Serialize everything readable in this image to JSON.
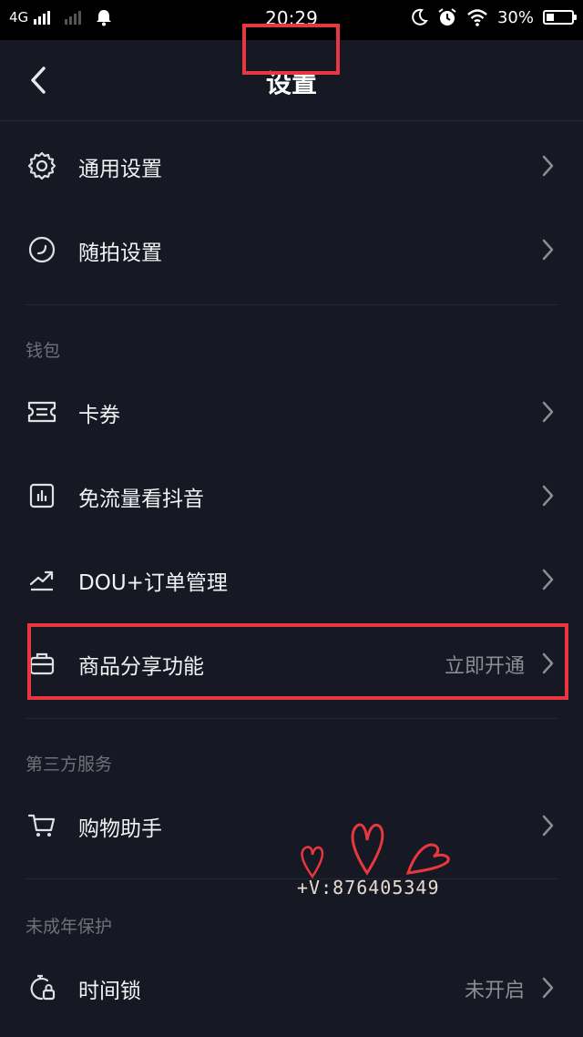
{
  "status_bar": {
    "network": "4G",
    "time": "20:29",
    "battery": "30%",
    "battery_level": 0.3
  },
  "header": {
    "title": "设置"
  },
  "sections": [
    {
      "title": "",
      "items": [
        {
          "label": "通用设置",
          "icon": "gear-icon"
        },
        {
          "label": "随拍设置",
          "icon": "circle-clock-icon"
        }
      ]
    },
    {
      "title": "钱包",
      "items": [
        {
          "label": "卡券",
          "icon": "ticket-icon"
        },
        {
          "label": "免流量看抖音",
          "icon": "data-chart-icon"
        },
        {
          "label": "DOU+订单管理",
          "icon": "trend-up-icon"
        },
        {
          "label": "商品分享功能",
          "icon": "briefcase-icon",
          "value": "立即开通"
        }
      ]
    },
    {
      "title": "第三方服务",
      "items": [
        {
          "label": "购物助手",
          "icon": "cart-icon"
        }
      ]
    },
    {
      "title": "未成年保护",
      "items": [
        {
          "label": "时间锁",
          "icon": "timer-lock-icon",
          "value": "未开启"
        }
      ]
    }
  ],
  "watermark": "+V:876405349",
  "colors": {
    "background": "#161823",
    "highlight": "#e8373f"
  }
}
